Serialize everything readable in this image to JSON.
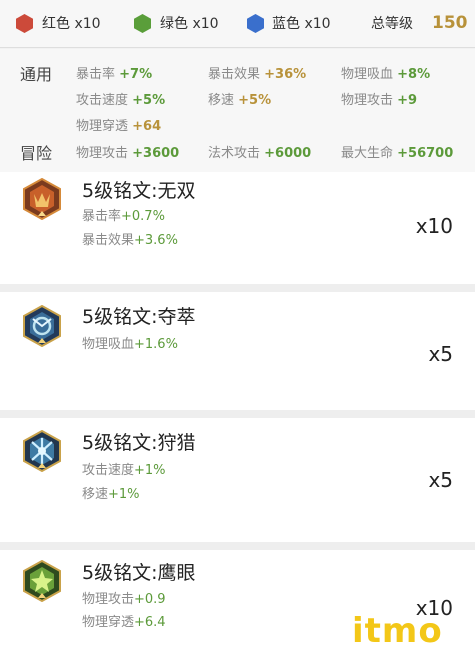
{
  "gems": [
    {
      "label": "红色 x10",
      "color": "#cc4a3a"
    },
    {
      "label": "绿色 x10",
      "color": "#5a9e3a"
    },
    {
      "label": "蓝色 x10",
      "color": "#3a6fcc"
    }
  ],
  "level": {
    "label": "总等级",
    "value": "150"
  },
  "summary": {
    "general": {
      "title": "通用",
      "stats": [
        {
          "name": "暴击率",
          "value": "+7%",
          "tone": "green"
        },
        {
          "name": "暴击效果",
          "value": "+36%",
          "tone": "gold"
        },
        {
          "name": "物理吸血",
          "value": "+8%",
          "tone": "green"
        },
        {
          "name": "攻击速度",
          "value": "+5%",
          "tone": "green"
        },
        {
          "name": "移速",
          "value": "+5%",
          "tone": "gold"
        },
        {
          "name": "物理攻击",
          "value": "+9",
          "tone": "green"
        },
        {
          "name": "物理穿透",
          "value": "+64",
          "tone": "gold"
        }
      ]
    },
    "adventure": {
      "title": "冒险",
      "stats": [
        {
          "name": "物理攻击",
          "value": "+3600",
          "tone": "green"
        },
        {
          "name": "法术攻击",
          "value": "+6000",
          "tone": "green"
        },
        {
          "name": "最大生命",
          "value": "+56700",
          "tone": "green"
        }
      ]
    }
  },
  "runes": [
    {
      "name": "5级铭文:无双",
      "icon": "rune-red-icon",
      "count": "x10",
      "stats": [
        {
          "name": "暴击率",
          "value": "+0.7%"
        },
        {
          "name": "暴击效果",
          "value": "+3.6%"
        }
      ]
    },
    {
      "name": "5级铭文:夺萃",
      "icon": "rune-blue-icon",
      "count": "x5",
      "stats": [
        {
          "name": "物理吸血",
          "value": "+1.6%"
        }
      ]
    },
    {
      "name": "5级铭文:狩猎",
      "icon": "rune-blue-icon",
      "count": "x5",
      "stats": [
        {
          "name": "攻击速度",
          "value": "+1%"
        },
        {
          "name": "移速",
          "value": "+1%"
        }
      ]
    },
    {
      "name": "5级铭文:鹰眼",
      "icon": "rune-green-icon",
      "count": "x10",
      "stats": [
        {
          "name": "物理攻击",
          "value": "+0.9"
        },
        {
          "name": "物理穿透",
          "value": "+6.4"
        }
      ]
    }
  ],
  "watermark": "itmo"
}
